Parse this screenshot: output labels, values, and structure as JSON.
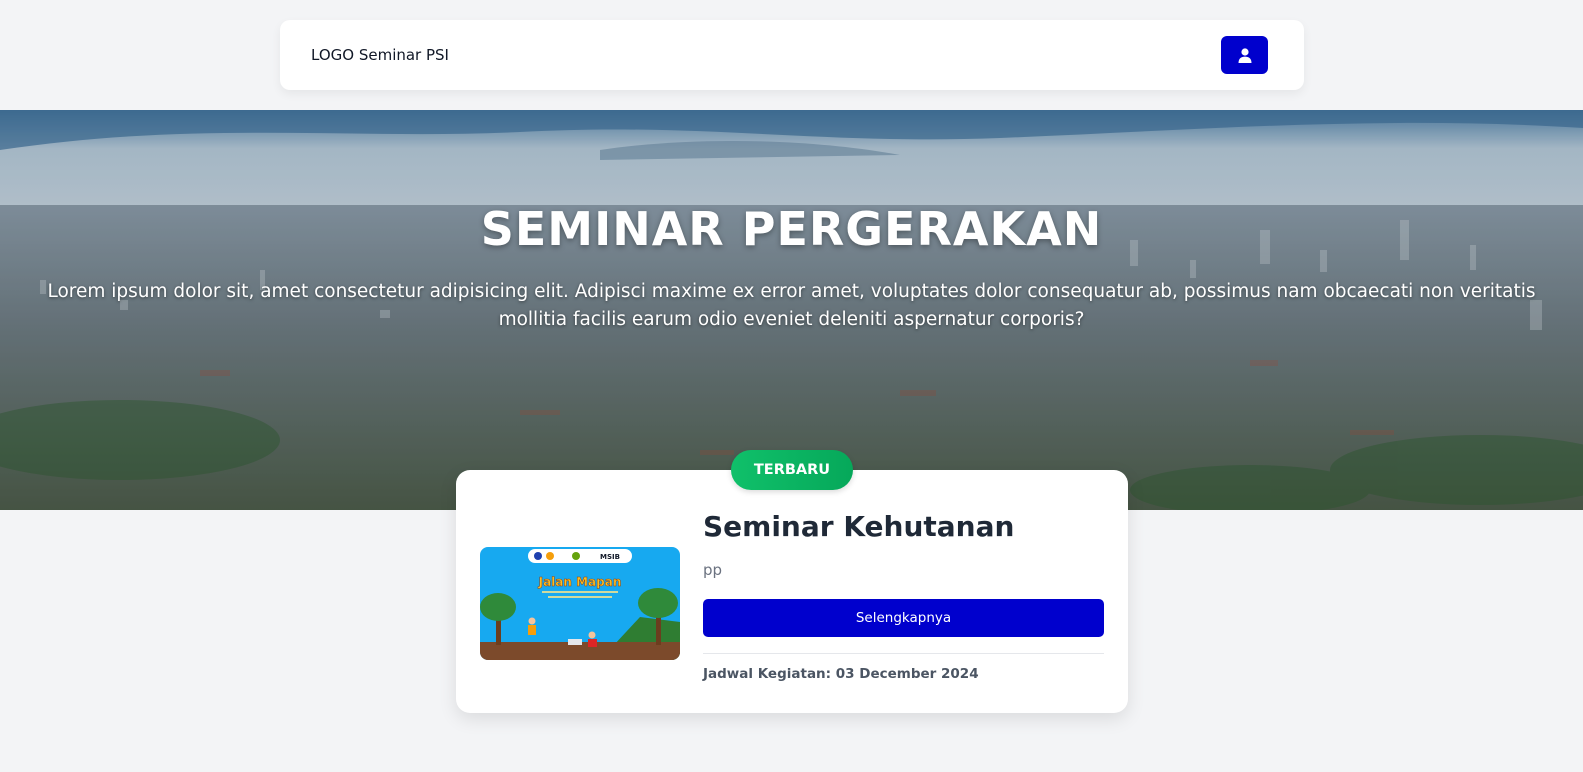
{
  "navbar": {
    "brand": "LOGO Seminar PSI",
    "user_icon": "user-icon",
    "accent_color": "#0000cd"
  },
  "hero": {
    "title": "SEMINAR PERGERAKAN",
    "description": "Lorem ipsum dolor sit, amet consectetur adipisicing elit. Adipisci maxime ex error amet, voluptates dolor consequatur ab, possimus nam obcaecati non veritatis mollitia facilis earum odio eveniet deleniti aspernatur corporis?"
  },
  "featured": {
    "badge": "TERBARU",
    "badge_color": "#06a85a",
    "title": "Seminar Kehutanan",
    "description": "pp",
    "button_label": "Selengkapnya",
    "schedule": "Jadwal Kegiatan: 03 December 2024",
    "thumbnail": {
      "logo_text": "MSIB",
      "headline": "Jalan Mapan"
    }
  }
}
